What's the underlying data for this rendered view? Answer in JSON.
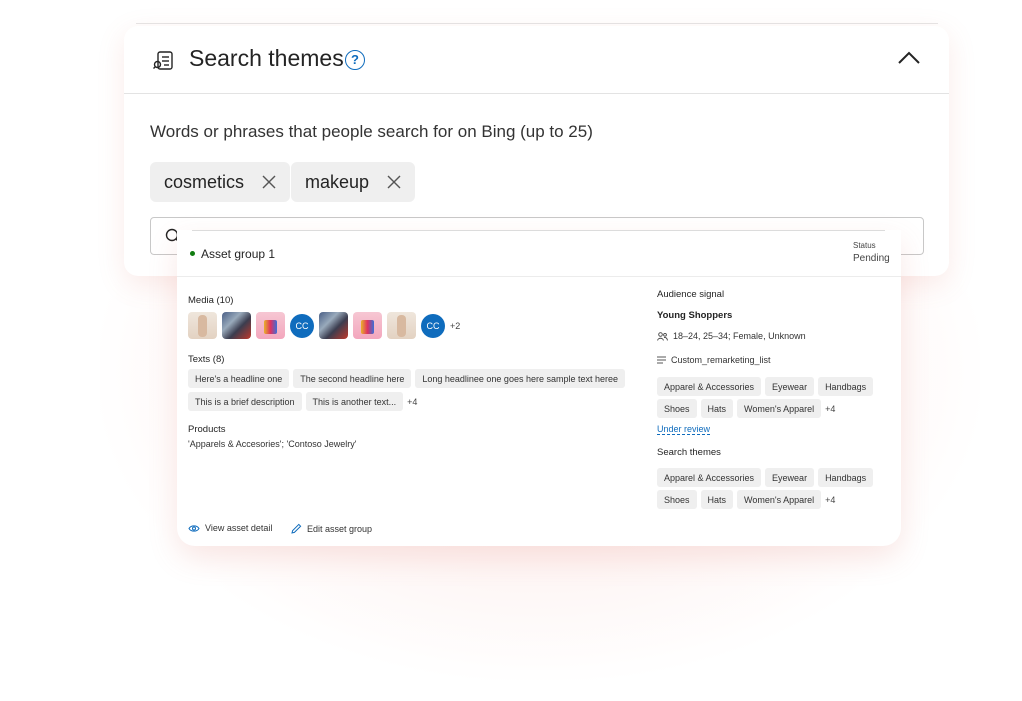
{
  "panel": {
    "title": "Search themes",
    "help_icon": "?",
    "description": "Words or phrases that people search for on Bing (up to 25)",
    "keywords": [
      "cosmetics",
      "makeup"
    ],
    "search_placeholder": ""
  },
  "asset_group": {
    "name": "Asset group 1",
    "status_label": "Status",
    "status_value": "Pending",
    "media": {
      "label": "Media (10)",
      "avatar_initials": "CC",
      "more": "+2"
    },
    "texts": {
      "label": "Texts (8)",
      "row1": [
        "Here's a headline one",
        "The second headline here",
        "Long headlinee one goes here sample text heree"
      ],
      "row2": [
        "This is a brief description",
        "This is another text..."
      ],
      "more": "+4"
    },
    "products": {
      "label": "Products",
      "value": "'Apparels & Accesories'; 'Contoso Jewelry'"
    },
    "audience": {
      "label": "Audience signal",
      "name": "Young Shoppers",
      "demographics": "18–24, 25–34; Female, Unknown",
      "list": "Custom_remarketing_list",
      "row1": [
        "Apparel & Accessories",
        "Eyewear",
        "Handbags"
      ],
      "row2": [
        "Shoes",
        "Hats",
        "Women's Apparel"
      ],
      "more": "+4",
      "review": "Under review"
    },
    "search_themes": {
      "label": "Search themes",
      "row1": [
        "Apparel & Accessories",
        "Eyewear",
        "Handbags"
      ],
      "row2": [
        "Shoes",
        "Hats",
        "Women's Apparel"
      ],
      "more": "+4"
    },
    "actions": {
      "view": "View asset detail",
      "edit": "Edit asset group"
    }
  },
  "colors": {
    "accent": "#0f6cbd",
    "status_dot": "#107c10",
    "chip_bg": "#efefef"
  }
}
